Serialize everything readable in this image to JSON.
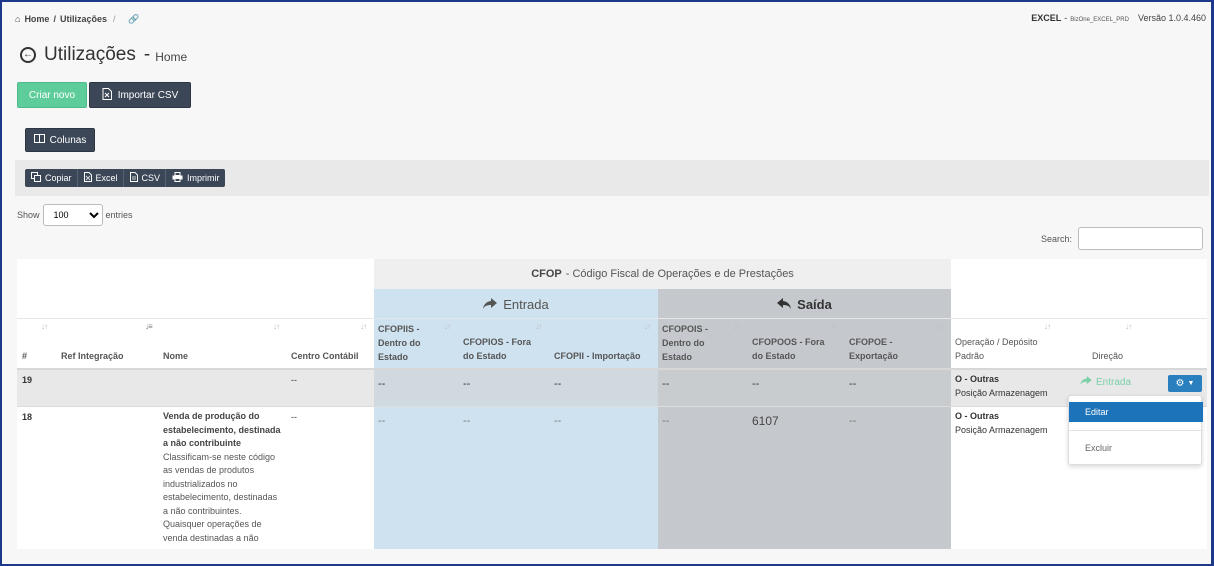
{
  "breadcrumb": {
    "home": "Home",
    "separator": "/",
    "current": "Utilizações",
    "trailing": "/"
  },
  "app": {
    "name": "EXCEL",
    "dash": "-",
    "env": "BizOne_EXCEL_PRD",
    "version": "Versão 1.0.4.460"
  },
  "page": {
    "title": "Utilizações",
    "dash": "-",
    "subtitle": "Home"
  },
  "toolbar": {
    "new_label": "Criar novo",
    "import_label": "Importar CSV",
    "columns_label": "Colunas"
  },
  "export": {
    "copy": "Copiar",
    "excel": "Excel",
    "csv": "CSV",
    "print": "Imprimir"
  },
  "length": {
    "show": "Show",
    "value": "100",
    "entries": "entries"
  },
  "search": {
    "label": "Search:",
    "value": ""
  },
  "table": {
    "group_title_bold": "CFOP",
    "group_title_rest": "- Código Fiscal de Operações e de Prestações",
    "entrada_label": "Entrada",
    "saida_label": "Saída",
    "headers": {
      "num": "#",
      "ref": "Ref Integração",
      "nome": "Nome",
      "centro": "Centro Contábil",
      "cfopiis": "CFOPIIS - Dentro do Estado",
      "cfopios": "CFOPIOS - Fora do Estado",
      "cfopii": "CFOPII - Importação",
      "cfopois": "CFOPOIS - Dentro do Estado",
      "cfopoos": "CFOPOOS - Fora do Estado",
      "cfopoe": "CFOPOE - Exportação",
      "operacao": "Operação / Depósito Padrão",
      "direcao": "Direção"
    },
    "rows": [
      {
        "num": "19",
        "ref": "",
        "nome": "",
        "centro": "--",
        "cfopiis": "--",
        "cfopios": "--",
        "cfopii": "--",
        "cfopois": "--",
        "cfopoos": "--",
        "cfopoe": "--",
        "operacao": "O - Outras",
        "deposito": "Posição Armazenagem",
        "direcao": "Entrada"
      },
      {
        "num": "18",
        "ref": "",
        "nome_title": "Venda de produção do estabelecimento, destinada a não contribuinte",
        "nome_desc": "Classificam-se neste código as vendas de produtos industrializados no estabelecimento, destinadas a não contribuintes. Quaisquer operações de venda destinadas a não",
        "centro": "--",
        "cfopiis": "--",
        "cfopios": "--",
        "cfopii": "--",
        "cfopois": "--",
        "cfopoos": "6107",
        "cfopoe": "--",
        "operacao": "O - Outras",
        "deposito": "Posição Armazenagem"
      }
    ]
  },
  "row_menu": {
    "edit": "Editar",
    "delete": "Excluir"
  },
  "colors": {
    "accent_green": "#5fcd9b",
    "dark_button": "#3b4657",
    "primary_blue": "#1d73b9",
    "entrada_bg": "#cfe2ef",
    "saida_bg": "#c5c9cd"
  }
}
